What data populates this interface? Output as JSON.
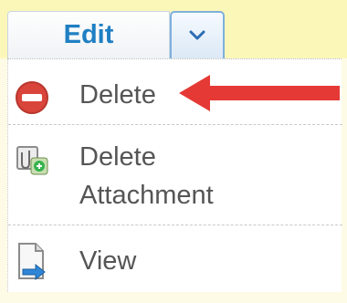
{
  "toolbar": {
    "edit_label": "Edit",
    "dropdown_icon": "chevron-down-icon"
  },
  "menu": {
    "items": [
      {
        "label": "Delete",
        "icon": "delete-icon"
      },
      {
        "label": "Delete Attachment",
        "icon": "delete-attachment-icon"
      },
      {
        "label": "View",
        "icon": "view-document-icon"
      }
    ]
  },
  "colors": {
    "edit_text": "#1f7fc3",
    "delete_icon": "#d9453b",
    "annotation_arrow": "#e53935",
    "background": "#fbf7b9"
  }
}
